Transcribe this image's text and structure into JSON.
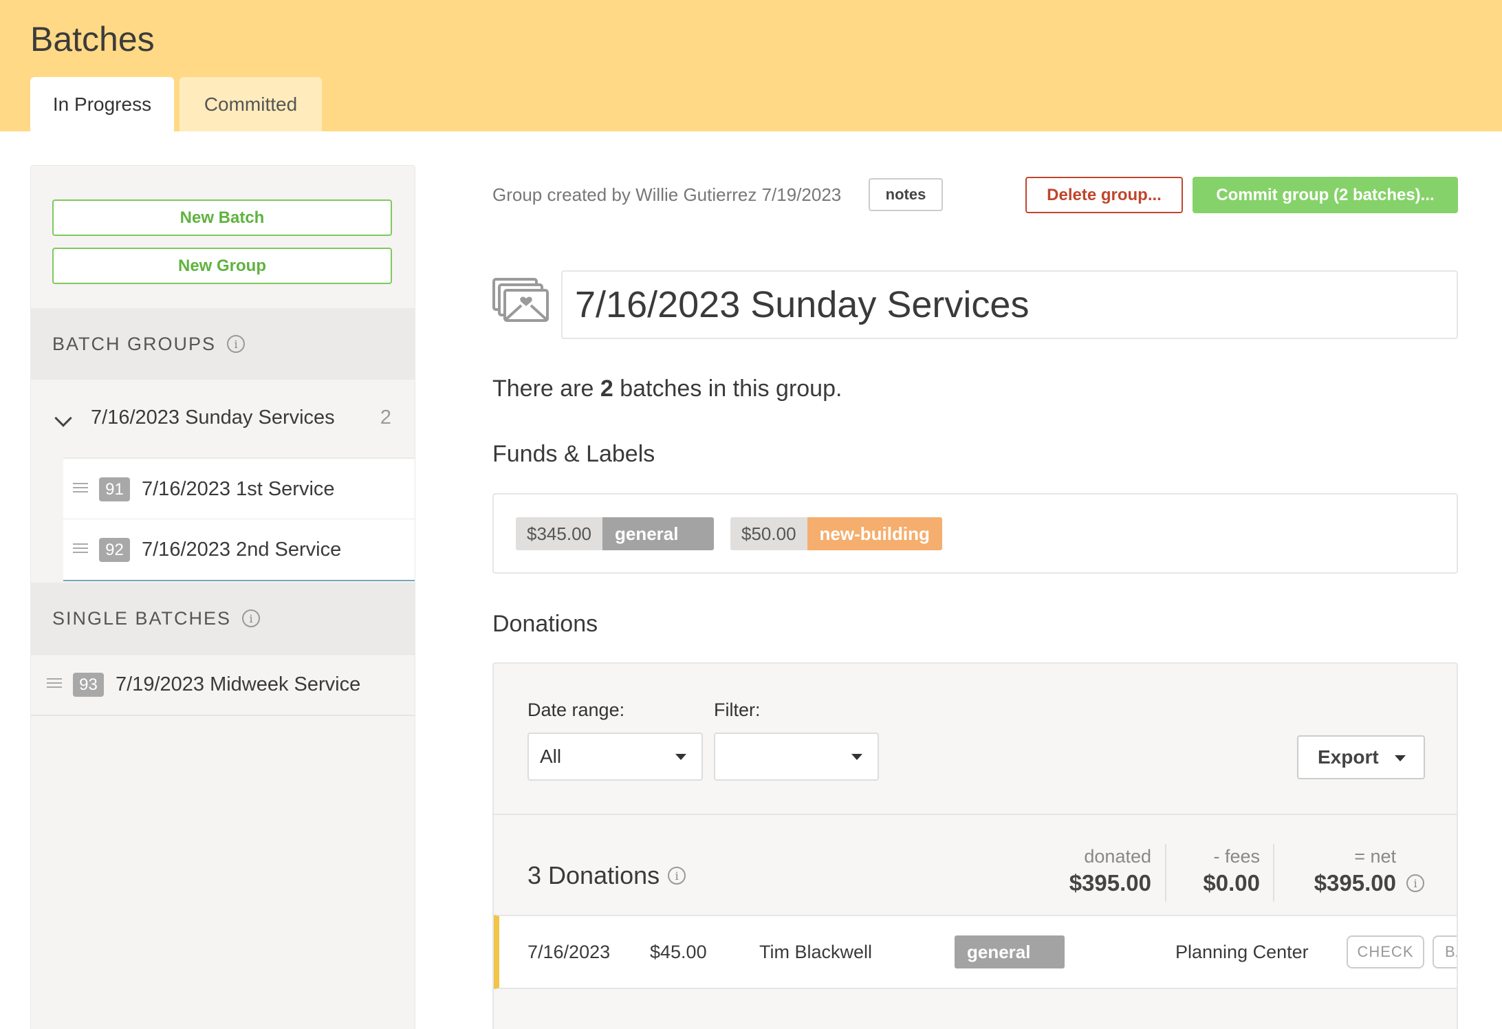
{
  "header": {
    "title": "Batches",
    "tabs": [
      {
        "label": "In Progress",
        "active": true
      },
      {
        "label": "Committed",
        "active": false
      }
    ]
  },
  "sidebar": {
    "new_batch_label": "New Batch",
    "new_group_label": "New Group",
    "batch_groups_heading": "BATCH GROUPS",
    "groups": [
      {
        "label": "7/16/2023 Sunday Services",
        "count": "2",
        "batches": [
          {
            "number": "91",
            "label": "7/16/2023 1st Service"
          },
          {
            "number": "92",
            "label": "7/16/2023 2nd Service"
          }
        ]
      }
    ],
    "single_batches_heading": "SINGLE BATCHES",
    "single_batches": [
      {
        "number": "93",
        "label": "7/19/2023 Midweek Service"
      }
    ]
  },
  "main": {
    "meta": "Group created by Willie Gutierrez 7/19/2023",
    "notes_label": "notes",
    "delete_label": "Delete group...",
    "commit_label": "Commit group (2 batches)...",
    "group_title": "7/16/2023 Sunday Services",
    "summary_prefix": "There are",
    "summary_count": "2",
    "summary_suffix": "batches in this group.",
    "funds_heading": "Funds & Labels",
    "funds": [
      {
        "amount": "$345.00",
        "label": "general",
        "color": "#a3a3a3"
      },
      {
        "amount": "$50.00",
        "label": "new-building",
        "color": "#f5ae6d"
      }
    ],
    "donations_heading": "Donations",
    "filters": {
      "date_range_label": "Date range:",
      "date_range_value": "All",
      "filter_label": "Filter:",
      "filter_value": "",
      "export_label": "Export"
    },
    "totals": {
      "count_label": "3 Donations",
      "donated_caption": "donated",
      "donated_value": "$395.00",
      "fees_caption": "- fees",
      "fees_value": "$0.00",
      "net_caption": "= net",
      "net_value": "$395.00"
    },
    "donations": [
      {
        "date": "7/16/2023",
        "amount": "$45.00",
        "donor": "Tim Blackwell",
        "fund": "general",
        "source": "Planning Center",
        "method": "CHECK",
        "method2": "BA"
      }
    ]
  },
  "colors": {
    "header_bg": "#ffd985",
    "accent_green": "#86d26a",
    "danger": "#c0452b",
    "row_accent": "#f2c447"
  }
}
